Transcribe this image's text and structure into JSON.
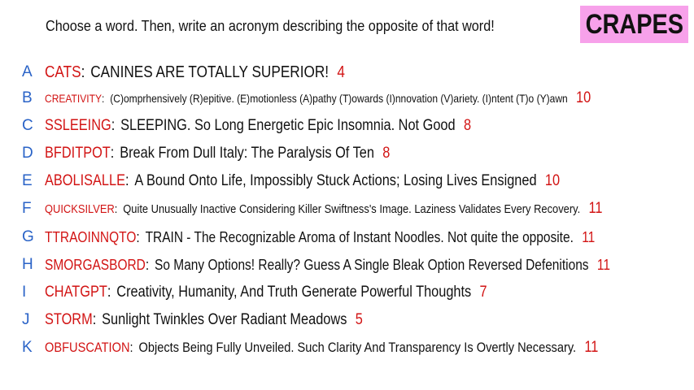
{
  "prompt": "Choose a word. Then, write an acronym describing the opposite of that word!",
  "logo": "CRAPES",
  "colors": {
    "letter": "#2a63c7",
    "word": "#d21414",
    "score": "#d21414",
    "logo_bg": "#f7a1ea"
  },
  "entries": [
    {
      "letter": "A",
      "word": "CATS",
      "definition": "CANINES ARE TOTALLY SUPERIOR!",
      "score": "4"
    },
    {
      "letter": "B",
      "word": "CREATIVITY",
      "definition": "(C)omprhensively (R)epitive. (E)motionless (A)pathy (T)owards  (I)nnovation (V)ariety. (I)ntent (T)o (Y)awn",
      "score": "10"
    },
    {
      "letter": "C",
      "word": "SSLEEING",
      "definition": "SLEEPING. So Long Energetic Epic Insomnia. Not Good",
      "score": "8"
    },
    {
      "letter": "D",
      "word": "BFDITPOT",
      "definition": "Break From Dull Italy: The Paralysis Of Ten",
      "score": "8"
    },
    {
      "letter": "E",
      "word": "ABOLISALLE",
      "definition": "A Bound Onto Life, Impossibly Stuck Actions; Losing Lives Ensigned",
      "score": "10"
    },
    {
      "letter": "F",
      "word": "QUICKSILVER",
      "definition": "Quite Unusually Inactive Considering Killer Swiftness's Image. Laziness Validates Every Recovery.",
      "score": "11"
    },
    {
      "letter": "G",
      "word": "TTRAOINNQTO",
      "definition": "TRAIN - The Recognizable Aroma of Instant Noodles. Not quite the opposite.",
      "score": "11"
    },
    {
      "letter": "H",
      "word": "SMORGASBORD",
      "definition": "So Many Options! Really? Guess A Single Bleak Option Reversed Defenitions",
      "score": "11"
    },
    {
      "letter": "I",
      "word": "CHATGPT",
      "definition": "Creativity, Humanity, And Truth Generate Powerful Thoughts",
      "score": "7"
    },
    {
      "letter": "J",
      "word": "STORM",
      "definition": "Sunlight Twinkles Over Radiant Meadows",
      "score": "5"
    },
    {
      "letter": "K",
      "word": "OBFUSCATION",
      "definition": "Objects Being Fully Unveiled. Such Clarity And Transparency Is Overtly Necessary.",
      "score": "11"
    }
  ]
}
